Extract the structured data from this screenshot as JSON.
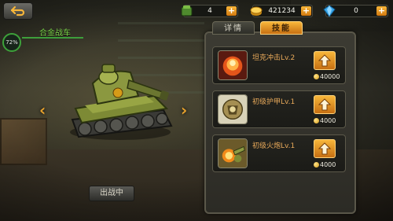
{
  "resources": {
    "food": {
      "value": "4",
      "icon": "food-crate-icon"
    },
    "gold": {
      "value": "421234",
      "icon": "gold-coin-icon"
    },
    "gems": {
      "value": "0",
      "icon": "gem-icon"
    },
    "plus": "+"
  },
  "tank": {
    "name": "合金战车",
    "power_percent": "72%",
    "deploy_label": "出战中",
    "prev_arrow": "‹",
    "next_arrow": "›"
  },
  "tabs": {
    "details": "详情",
    "skills": "技能"
  },
  "skills": [
    {
      "name": "坦克冲击Lv.2",
      "cost": "40000",
      "icon": "explosion-icon"
    },
    {
      "name": "初级护甲Lv.1",
      "cost": "4000",
      "icon": "armor-icon"
    },
    {
      "name": "初级火炮Lv.1",
      "cost": "4000",
      "icon": "cannon-icon"
    }
  ],
  "colors": {
    "accent": "#f7b63a",
    "name_green": "#7cd64b",
    "skill_text": "#e8a95a"
  }
}
